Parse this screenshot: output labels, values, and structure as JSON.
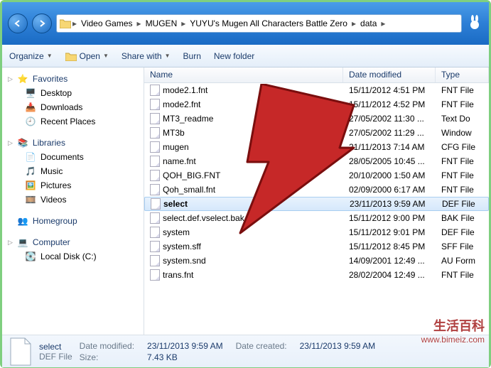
{
  "breadcrumbs": [
    "Video Games",
    "MUGEN",
    "YUYU's Mugen All Characters Battle Zero",
    "data"
  ],
  "toolbar": {
    "organize": "Organize",
    "open": "Open",
    "share": "Share with",
    "burn": "Burn",
    "newfolder": "New folder"
  },
  "sidebar": {
    "favorites": {
      "label": "Favorites",
      "items": [
        "Desktop",
        "Downloads",
        "Recent Places"
      ]
    },
    "libraries": {
      "label": "Libraries",
      "items": [
        "Documents",
        "Music",
        "Pictures",
        "Videos"
      ]
    },
    "homegroup": {
      "label": "Homegroup"
    },
    "computer": {
      "label": "Computer",
      "items": [
        "Local Disk (C:)"
      ]
    }
  },
  "columns": {
    "name": "Name",
    "date": "Date modified",
    "type": "Type"
  },
  "files": [
    {
      "name": "mode2.1.fnt",
      "date": "15/11/2012 4:51 PM",
      "type": "FNT File"
    },
    {
      "name": "mode2.fnt",
      "date": "15/11/2012 4:52 PM",
      "type": "FNT File"
    },
    {
      "name": "MT3_readme",
      "date": "27/05/2002 11:30 ...",
      "type": "Text Do"
    },
    {
      "name": "MT3b",
      "date": "27/05/2002 11:29 ...",
      "type": "Window"
    },
    {
      "name": "mugen",
      "date": "21/11/2013 7:14 AM",
      "type": "CFG File"
    },
    {
      "name": "name.fnt",
      "date": "28/05/2005 10:45 ...",
      "type": "FNT File"
    },
    {
      "name": "QOH_BIG.FNT",
      "date": "20/10/2000 1:50 AM",
      "type": "FNT File"
    },
    {
      "name": "Qoh_small.fnt",
      "date": "02/09/2000 6:17 AM",
      "type": "FNT File"
    },
    {
      "name": "select",
      "date": "23/11/2013 9:59 AM",
      "type": "DEF File",
      "selected": true
    },
    {
      "name": "select.def.vselect.bak",
      "date": "15/11/2012 9:00 PM",
      "type": "BAK File"
    },
    {
      "name": "system",
      "date": "15/11/2012 9:01 PM",
      "type": "DEF File"
    },
    {
      "name": "system.sff",
      "date": "15/11/2012 8:45 PM",
      "type": "SFF File"
    },
    {
      "name": "system.snd",
      "date": "14/09/2001 12:49 ...",
      "type": "AU Form"
    },
    {
      "name": "trans.fnt",
      "date": "28/02/2004 12:49 ...",
      "type": "FNT File"
    }
  ],
  "details": {
    "name": "select",
    "type": "DEF File",
    "mod_lab": "Date modified:",
    "mod_val": "23/11/2013 9:59 AM",
    "size_lab": "Size:",
    "size_val": "7.43 KB",
    "created_lab": "Date created:",
    "created_val": "23/11/2013 9:59 AM"
  },
  "watermark": {
    "line1": "生活百科",
    "line2": "www.bimeiz.com"
  }
}
